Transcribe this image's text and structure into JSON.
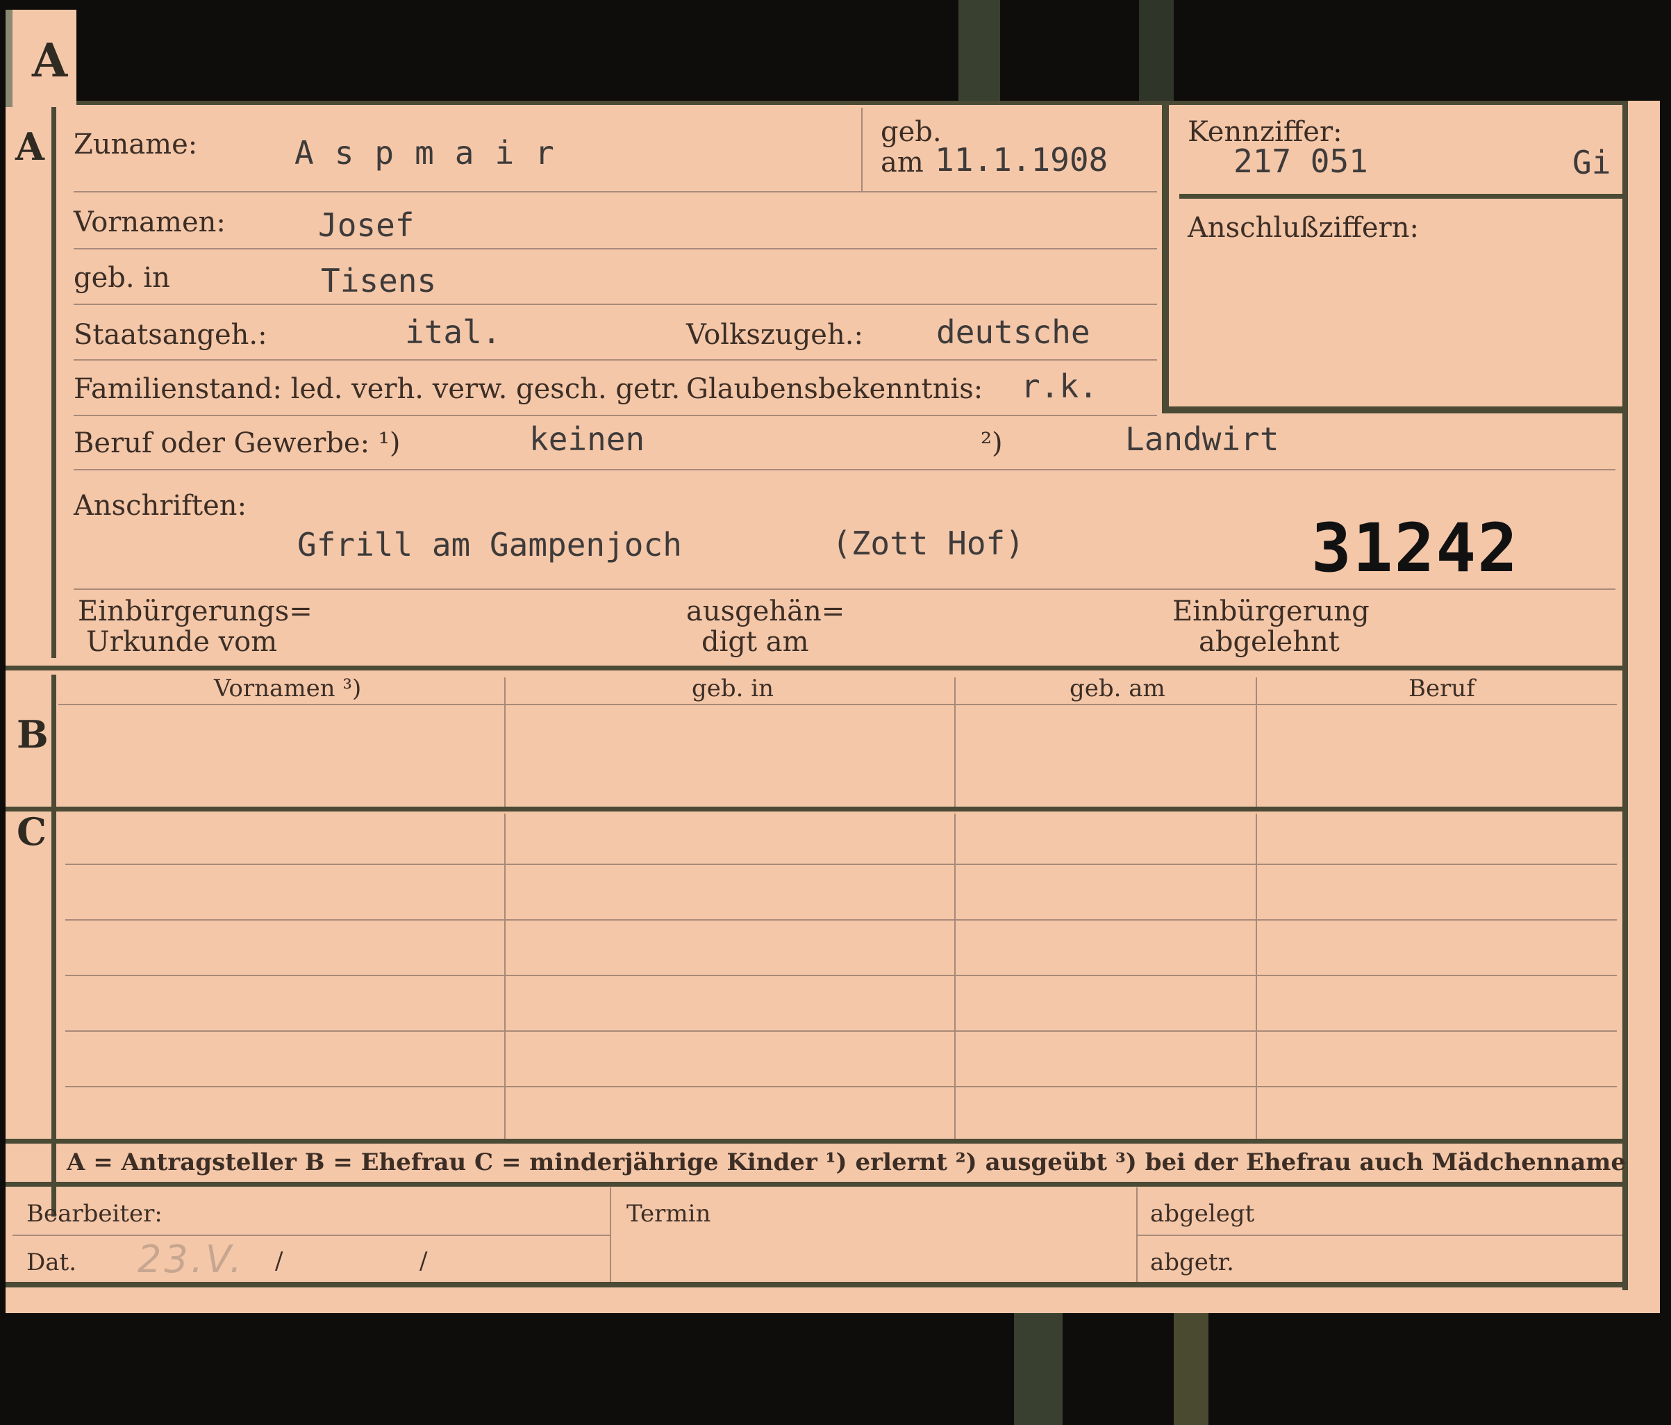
{
  "tab": {
    "letter": "A"
  },
  "sections": {
    "a": "A",
    "b": "B",
    "c": "C"
  },
  "labels": {
    "zuname": "Zuname:",
    "geb": "geb.",
    "am": "am",
    "kennziffer": "Kennziffer:",
    "anschlussziffern": "Anschlußziffern:",
    "vornamen": "Vornamen:",
    "geb_in": "geb. in",
    "staatsangeh": "Staatsangeh.:",
    "volkszugeh": "Volkszugeh.:",
    "familienstand": "Familienstand: led. verh. verw. gesch. getr.",
    "glaubensbekenntnis": "Glaubensbekenntnis:",
    "beruf": "Beruf oder Gewerbe: ¹)",
    "beruf2": "²)",
    "anschriften": "Anschriften:",
    "einbuergerung_urkunde_1": "Einbürgerungs=",
    "einbuergerung_urkunde_2": "Urkunde vom",
    "ausgehaendigt_1": "ausgehän=",
    "ausgehaendigt_2": "digt am",
    "einbuergerung_abgelehnt_1": "Einbürgerung",
    "einbuergerung_abgelehnt_2": "abgelehnt",
    "bearbeiter": "Bearbeiter:",
    "dat": "Dat.",
    "termin": "Termin",
    "abgelegt": "abgelegt",
    "abgetr": "abgetr."
  },
  "values": {
    "zuname": "Aspmair",
    "geb_am": "11.1.1908",
    "kennziffer": "217 051",
    "kennziffer_suffix": "Gi",
    "vornamen": "Josef",
    "geb_in": "Tisens",
    "staatsangeh": "ital.",
    "volkszugeh": "deutsche",
    "glaubensbekenntnis": "r.k.",
    "beruf_erlernt": "keinen",
    "beruf_ausgeuebt": "Landwirt",
    "anschrift": "Gfrill am Gampenjoch",
    "anschrift_hof": "(Zott Hof)",
    "stamp_number": "31242",
    "dat_pencil": "23.V.",
    "dat_slash1": "/",
    "dat_slash2": "/"
  },
  "table": {
    "headers": [
      "Vornamen ³)",
      "geb. in",
      "geb. am",
      "Beruf"
    ]
  },
  "legend": "A = Antragsteller   B = Ehefrau   C = minderjährige Kinder   ¹) erlernt   ²) ausgeübt   ³) bei der Ehefrau auch Mädchenname"
}
